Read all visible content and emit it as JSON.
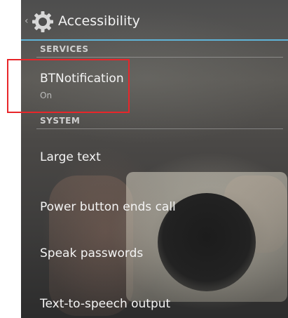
{
  "action_bar": {
    "up_caret": "‹",
    "title": "Accessibility",
    "icon": "gear-icon",
    "accent_color": "#5fb4d8"
  },
  "sections": {
    "services": {
      "header": "SERVICES",
      "items": [
        {
          "title": "BTNotification",
          "summary": "On"
        }
      ]
    },
    "system": {
      "header": "SYSTEM",
      "items": [
        {
          "title": "Large text"
        },
        {
          "title": "Power button ends call"
        },
        {
          "title": "Speak passwords"
        },
        {
          "title": "Text-to-speech output"
        }
      ]
    }
  },
  "annotation": {
    "highlight_color": "#e8262a"
  }
}
